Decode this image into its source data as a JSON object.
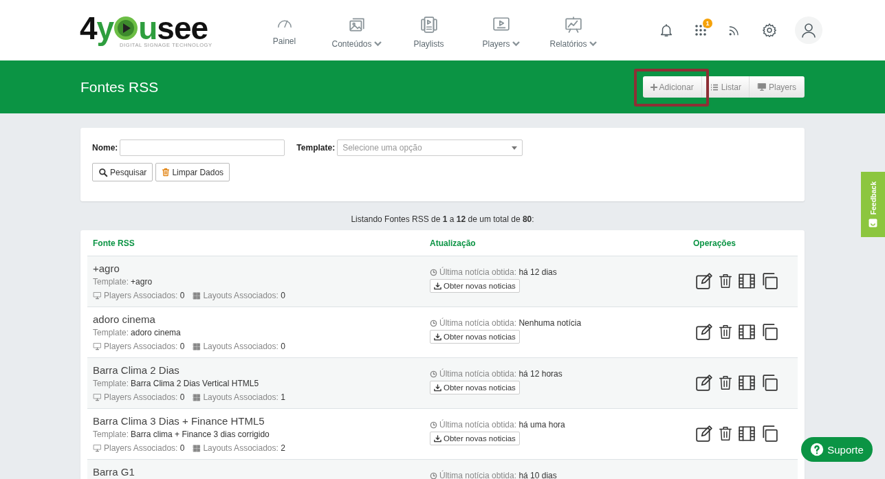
{
  "logo": {
    "parts": [
      {
        "text": "4",
        "color": "#111111"
      },
      {
        "text": "y",
        "color": "#2e9e3e"
      },
      {
        "text": "u",
        "color": "#2e9e3e"
      },
      {
        "text": "see",
        "color": "#111111"
      }
    ],
    "tagline": "DIGITAL SIGNAGE TECHNOLOGY"
  },
  "nav": [
    {
      "label": "Painel",
      "dropdown": false
    },
    {
      "label": "Conteúdos",
      "dropdown": true
    },
    {
      "label": "Playlists",
      "dropdown": false
    },
    {
      "label": "Players",
      "dropdown": true
    },
    {
      "label": "Relatórios",
      "dropdown": true
    }
  ],
  "notifications": {
    "apps_badge": "1"
  },
  "page": {
    "title": "Fontes RSS",
    "actions": [
      {
        "label": "Adicionar",
        "highlighted": true
      },
      {
        "label": "Listar",
        "highlighted": false
      },
      {
        "label": "Players",
        "highlighted": false
      }
    ]
  },
  "filters": {
    "name_label": "Nome:",
    "template_label": "Template:",
    "template_placeholder": "Selecione uma opção",
    "buttons": [
      "Pesquisar",
      "Limpar Dados"
    ]
  },
  "summary": "Listando Fontes RSS de **1** a **12** de um total de **80**:",
  "table": {
    "columns": [
      "Fonte RSS",
      "Atualização",
      "Operações"
    ],
    "rows": [
      {
        "title": "+agro",
        "template_label": "Template:",
        "template": "+agro",
        "players_label": "Players Associados:",
        "players": "0",
        "layouts_label": "Layouts Associados:",
        "layouts": "0",
        "update_label": "Última notícia obtida:",
        "update": "há 12 dias",
        "fetch_button": "Obter novas noticias"
      },
      {
        "title": "adoro cinema",
        "template_label": "Template:",
        "template": "adoro cinema",
        "players_label": "Players Associados:",
        "players": "0",
        "layouts_label": "Layouts Associados:",
        "layouts": "0",
        "update_label": "Última notícia obtida:",
        "update": "Nenhuma notícia",
        "fetch_button": "Obter novas noticias"
      },
      {
        "title": "Barra Clima 2 Dias",
        "template_label": "Template:",
        "template": "Barra Clima 2 Dias Vertical HTML5",
        "players_label": "Players Associados:",
        "players": "0",
        "layouts_label": "Layouts Associados:",
        "layouts": "1",
        "update_label": "Última notícia obtida:",
        "update": "há 12 horas",
        "fetch_button": "Obter novas noticias"
      },
      {
        "title": "Barra Clima 3 Dias + Finance HTML5",
        "template_label": "Template:",
        "template": "Barra clima + Finance 3 dias corrigido",
        "players_label": "Players Associados:",
        "players": "0",
        "layouts_label": "Layouts Associados:",
        "layouts": "2",
        "update_label": "Última notícia obtida:",
        "update": "há uma hora",
        "fetch_button": "Obter novas noticias"
      },
      {
        "title": "Barra G1",
        "update_label": "Última notícia obtida:",
        "update": "há 10 dias"
      }
    ]
  },
  "feedback": "Feedback",
  "support": "Suporte"
}
